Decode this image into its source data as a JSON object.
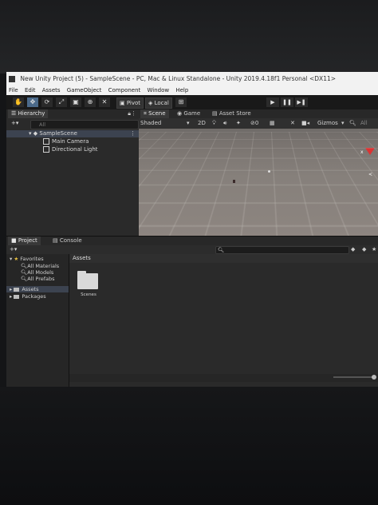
{
  "window": {
    "title": "New Unity Project (5) - SampleScene - PC, Mac & Linux Standalone - Unity 2019.4.18f1 Personal <DX11>"
  },
  "menu": [
    "File",
    "Edit",
    "Assets",
    "GameObject",
    "Component",
    "Window",
    "Help"
  ],
  "toolbar": {
    "pivot_label": "Pivot",
    "local_label": "Local",
    "play_icon": "play-icon",
    "pause_icon": "pause-icon",
    "step_icon": "step-icon"
  },
  "hierarchy": {
    "tab_label": "Hierarchy",
    "add_label": "+▾",
    "search_placeholder": "All",
    "scene_name": "SampleScene",
    "objects": [
      "Main Camera",
      "Directional Light"
    ]
  },
  "scene": {
    "tabs": [
      "Scene",
      "Game",
      "Asset Store"
    ],
    "shading_mode": "Shaded",
    "mode_2d_label": "2D",
    "gizmos_label": "Gizmos",
    "search_placeholder": "All"
  },
  "project": {
    "tabs": [
      "Project",
      "Console"
    ],
    "add_label": "+▾",
    "favorites_label": "Favorites",
    "favorites": [
      "All Materials",
      "All Models",
      "All Prefabs"
    ],
    "tree": [
      "Assets",
      "Packages"
    ],
    "breadcrumb": "Assets",
    "items": [
      "Scenes"
    ]
  },
  "colors": {
    "accent": "#4c6a8a",
    "editor_bg": "#2a2a2a",
    "scene_ground": "#86807b"
  }
}
